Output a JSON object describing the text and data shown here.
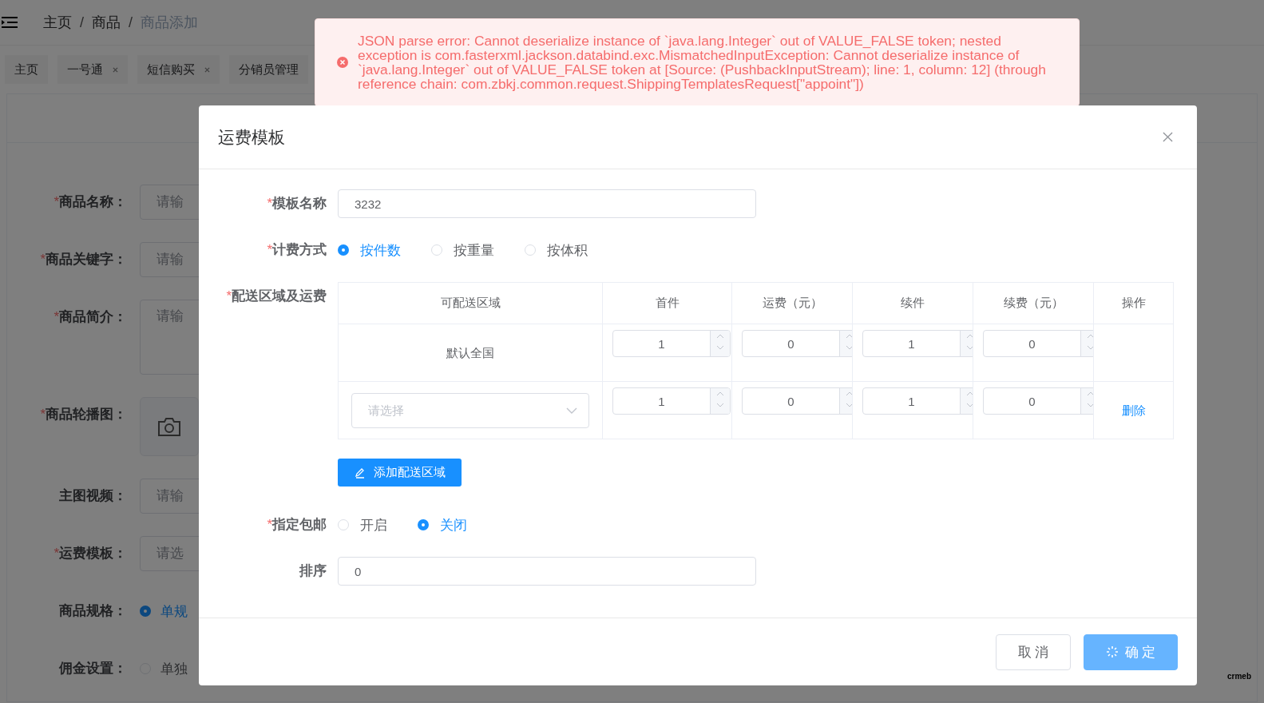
{
  "header": {
    "separators": [
      "/",
      "/"
    ],
    "breadcrumb": [
      {
        "label": "主页",
        "current": false
      },
      {
        "label": "商品",
        "current": false
      },
      {
        "label": "商品添加",
        "current": true
      }
    ]
  },
  "tabs": [
    {
      "label": "主页",
      "closable": false
    },
    {
      "label": "一号通",
      "closable": true
    },
    {
      "label": "短信购买",
      "closable": true
    },
    {
      "label": "分销员管理",
      "closable": false
    }
  ],
  "background_form": [
    {
      "label": "商品名称：",
      "required_mark": "*",
      "kind": "input",
      "placeholder": "请输"
    },
    {
      "label": "商品关键字：",
      "required_mark": "*",
      "kind": "input",
      "placeholder": "请输"
    },
    {
      "label": "商品简介：",
      "required_mark": "*",
      "kind": "textarea",
      "placeholder": "请输"
    },
    {
      "label": "商品轮播图：",
      "required_mark": "*",
      "kind": "upload"
    },
    {
      "label": "主图视频：",
      "kind": "input",
      "placeholder": "请输"
    },
    {
      "label": "运费模板：",
      "required_mark": "*",
      "kind": "input",
      "placeholder": "请选"
    },
    {
      "label": "商品规格：",
      "kind": "radio",
      "option": "单规",
      "checked": true
    },
    {
      "label": "佣金设置：",
      "kind": "radio",
      "option": "单独",
      "checked": false
    }
  ],
  "toast": {
    "message": "JSON parse error: Cannot deserialize instance of `java.lang.Integer` out of VALUE_FALSE token; nested exception is com.fasterxml.jackson.databind.exc.MismatchedInputException: Cannot deserialize instance of `java.lang.Integer` out of VALUE_FALSE token at [Source: (PushbackInputStream); line: 1, column: 12] (through reference chain: com.zbkj.common.request.ShippingTemplatesRequest[\"appoint\"])"
  },
  "dialog": {
    "title": "运费模板",
    "name_field": {
      "label": "模板名称",
      "required_mark": "*",
      "value": "3232"
    },
    "billing": {
      "label": "计费方式",
      "required_mark": "*",
      "options": [
        {
          "label": "按件数",
          "selected": true
        },
        {
          "label": "按重量",
          "selected": false
        },
        {
          "label": "按体积",
          "selected": false
        }
      ]
    },
    "regions": {
      "label": "配送区域及运费",
      "required_mark": "*",
      "columns": [
        "可配送区域",
        "首件",
        "运费（元）",
        "续件",
        "续费（元）",
        "操作"
      ],
      "rows": [
        {
          "kind": "default",
          "region": "默认全国",
          "values": [
            "1",
            "0",
            "1",
            "0"
          ]
        },
        {
          "kind": "select",
          "placeholder": "请选择",
          "values": [
            "1",
            "0",
            "1",
            "0"
          ],
          "action": "删除"
        }
      ],
      "add_button": "添加配送区域"
    },
    "free_shipping": {
      "label": "指定包邮",
      "required_mark": "*",
      "options": [
        {
          "label": "开启",
          "selected": false
        },
        {
          "label": "关闭",
          "selected": true
        }
      ]
    },
    "sort_field": {
      "label": "排序",
      "value": "0"
    },
    "buttons": [
      {
        "label": "取 消",
        "kind": "default",
        "loading": false
      },
      {
        "label": "确 定",
        "kind": "primary",
        "loading": true
      }
    ]
  },
  "logo": "crmeb"
}
